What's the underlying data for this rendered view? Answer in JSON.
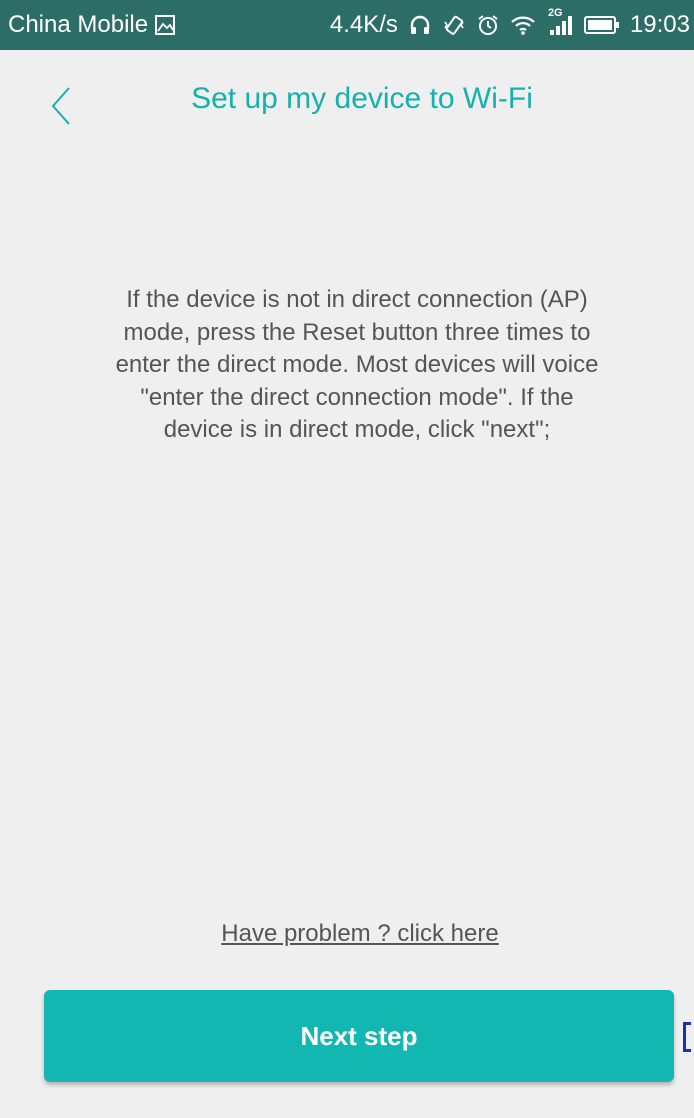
{
  "status_bar": {
    "carrier": "China Mobile",
    "speed": "4.4K/s",
    "network_type": "2G",
    "time": "19:03",
    "icons": [
      "image-icon",
      "headphones-icon",
      "vibrate-icon",
      "alarm-icon",
      "wifi-icon",
      "signal-icon",
      "battery-icon"
    ]
  },
  "header": {
    "title": "Set up my device to Wi-Fi",
    "back_icon": "chevron-left-icon"
  },
  "main": {
    "instructions": "If the device is not in direct connection (AP) mode, press the Reset button three times to enter the direct mode. Most devices will voice \"enter the direct connection mode\". If the device is in direct mode, click \"next\";"
  },
  "footer": {
    "problem_link": "Have problem ? click here",
    "next_label": "Next step"
  },
  "colors": {
    "accent": "#13b7b2",
    "title": "#13b2ad",
    "status_bar_bg": "#2d6d68",
    "background": "#efefef",
    "body_text": "#555555"
  }
}
